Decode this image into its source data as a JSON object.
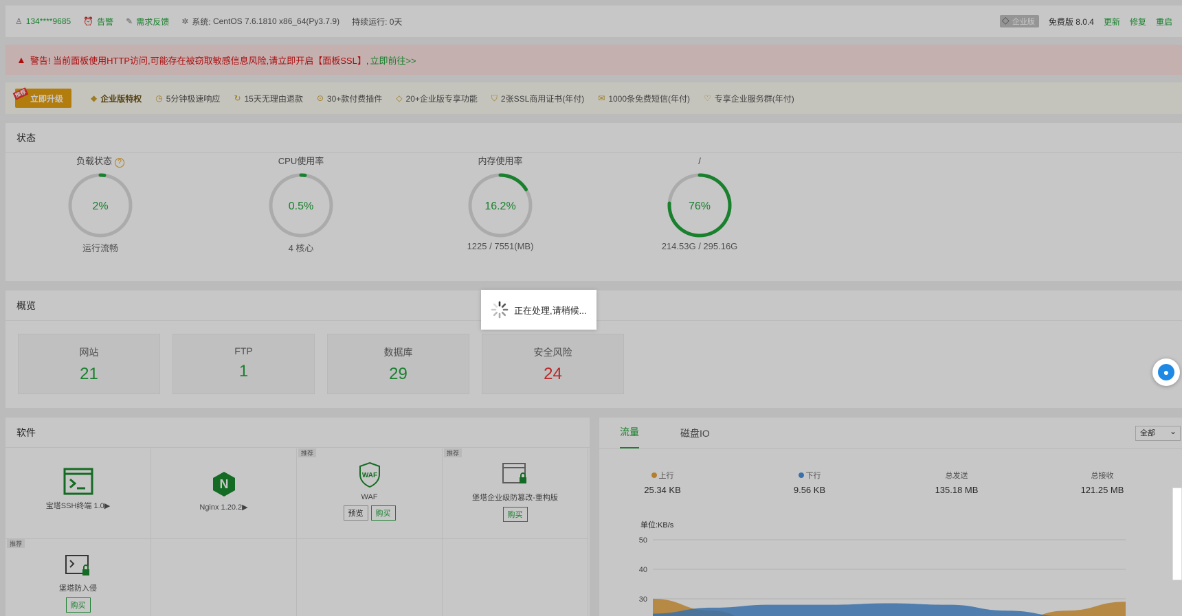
{
  "topbar": {
    "user": "134****9685",
    "alarm": "告警",
    "feedback": "需求反馈",
    "system_label": "系统:",
    "system_value": "CentOS 7.6.1810 x86_64(Py3.7.9)",
    "uptime": "持续运行: 0天",
    "edition_badge": "企业版",
    "version": "免费版 8.0.4",
    "update": "更新",
    "repair": "修复",
    "restart": "重启"
  },
  "alert": {
    "text": "警告! 当前面板使用HTTP访问,可能存在被窃取敏感信息风险,请立即开启【面板SSL】,",
    "link": "立即前往>>"
  },
  "vip": {
    "upgrade_tag": "推荐",
    "upgrade_label": "立即升级",
    "features": [
      {
        "icon": "diamond-icon",
        "label": "企业版特权"
      },
      {
        "icon": "clock-icon",
        "label": "5分钟极速响应"
      },
      {
        "icon": "refund-icon",
        "label": "15天无理由退款"
      },
      {
        "icon": "plugin-icon",
        "label": "30+款付费插件"
      },
      {
        "icon": "feature-icon",
        "label": "20+企业版专享功能"
      },
      {
        "icon": "ssl-icon",
        "label": "2张SSL商用证书(年付)"
      },
      {
        "icon": "mail-icon",
        "label": "1000条免费短信(年付)"
      },
      {
        "icon": "service-icon",
        "label": "专享企业服务群(年付)"
      }
    ]
  },
  "status": {
    "title": "状态",
    "gauges": [
      {
        "title": "负载状态",
        "value": "2%",
        "percent": 2,
        "sub": "运行流畅",
        "help": "?"
      },
      {
        "title": "CPU使用率",
        "value": "0.5%",
        "percent": 0.5,
        "sub": "4 核心"
      },
      {
        "title": "内存使用率",
        "value": "16.2%",
        "percent": 16.2,
        "sub": "1225 / 7551(MB)"
      },
      {
        "title": "/",
        "value": "76%",
        "percent": 76,
        "sub": "214.53G / 295.16G"
      }
    ]
  },
  "overview": {
    "title": "概览",
    "boxes": [
      {
        "label": "网站",
        "value": "21"
      },
      {
        "label": "FTP",
        "value": "1"
      },
      {
        "label": "数据库",
        "value": "29"
      },
      {
        "label": "安全风险",
        "value": "24"
      }
    ]
  },
  "software": {
    "title": "软件",
    "items": [
      {
        "name": "宝塔SSH终端 1.0▶",
        "icon": "terminal-icon",
        "rec": "",
        "buttons": []
      },
      {
        "name": "Nginx 1.20.2▶",
        "icon": "nginx-icon",
        "rec": "",
        "buttons": []
      },
      {
        "name": "WAF",
        "icon": "waf-icon",
        "rec": "推荐",
        "buttons": [
          "预览",
          "购买"
        ]
      },
      {
        "name": "堡塔企业级防篡改-重构版",
        "icon": "tamper-icon",
        "rec": "推荐",
        "buttons": [
          "购买"
        ]
      },
      {
        "name": "堡塔防入侵",
        "icon": "intrusion-icon",
        "rec": "推荐",
        "buttons": [
          "购买"
        ]
      }
    ]
  },
  "traffic": {
    "tabs": [
      "流量",
      "磁盘IO"
    ],
    "select": "全部",
    "stats": [
      {
        "label": "上行",
        "value": "25.34 KB",
        "dot": "#e6a23c"
      },
      {
        "label": "下行",
        "value": "9.56 KB",
        "dot": "#4a90d9"
      },
      {
        "label": "总发送",
        "value": "135.18 MB"
      },
      {
        "label": "总接收",
        "value": "121.25 MB"
      }
    ]
  },
  "chart_data": {
    "type": "area",
    "ylabel": "单位:KB/s",
    "yticks": [
      30,
      40,
      50
    ],
    "ylim": [
      0,
      50
    ],
    "series": [
      {
        "name": "上行",
        "color": "#e6a23c",
        "values": [
          30,
          26,
          20,
          20,
          20,
          20,
          22,
          26,
          29
        ]
      },
      {
        "name": "下行",
        "color": "#4a90d9",
        "values": [
          25,
          27,
          28,
          28,
          28.5,
          28,
          26,
          24,
          24
        ]
      }
    ]
  },
  "loading": {
    "text": "正在处理,请稍候..."
  }
}
